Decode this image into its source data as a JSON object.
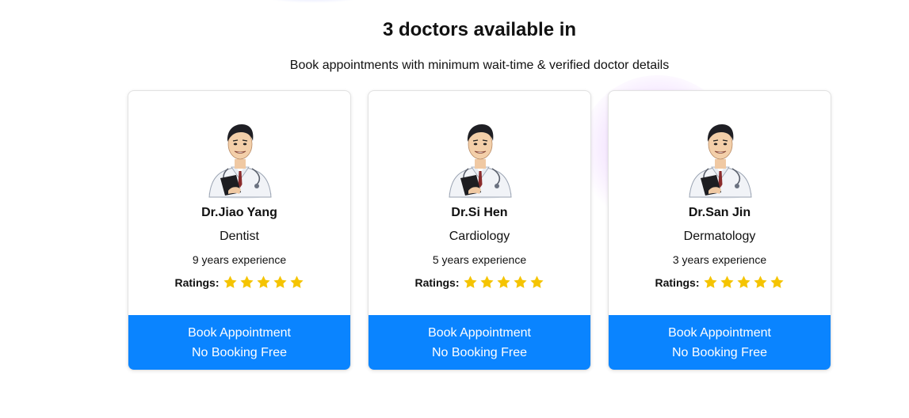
{
  "header": {
    "title": "3 doctors available in",
    "subtitle": "Book appointments with minimum wait-time & verified doctor details"
  },
  "doctors": [
    {
      "name": "Dr.Jiao Yang",
      "specialty": "Dentist",
      "experience": "9 years experience",
      "ratings_label": "Ratings:",
      "rating": 5,
      "book_line1": "Book Appointment",
      "book_line2": "No Booking Free"
    },
    {
      "name": "Dr.Si Hen",
      "specialty": "Cardiology",
      "experience": "5 years experience",
      "ratings_label": "Ratings:",
      "rating": 5,
      "book_line1": "Book Appointment",
      "book_line2": "No Booking Free"
    },
    {
      "name": "Dr.San Jin",
      "specialty": "Dermatology",
      "experience": "3 years experience",
      "ratings_label": "Ratings:",
      "rating": 5,
      "book_line1": "Book Appointment",
      "book_line2": "No Booking Free"
    }
  ],
  "colors": {
    "accent": "#0a84ff",
    "star": "#f5c400",
    "glow": "#c58cff"
  },
  "icons": {
    "avatar": "doctor-illustration",
    "rating": "star-icon"
  }
}
